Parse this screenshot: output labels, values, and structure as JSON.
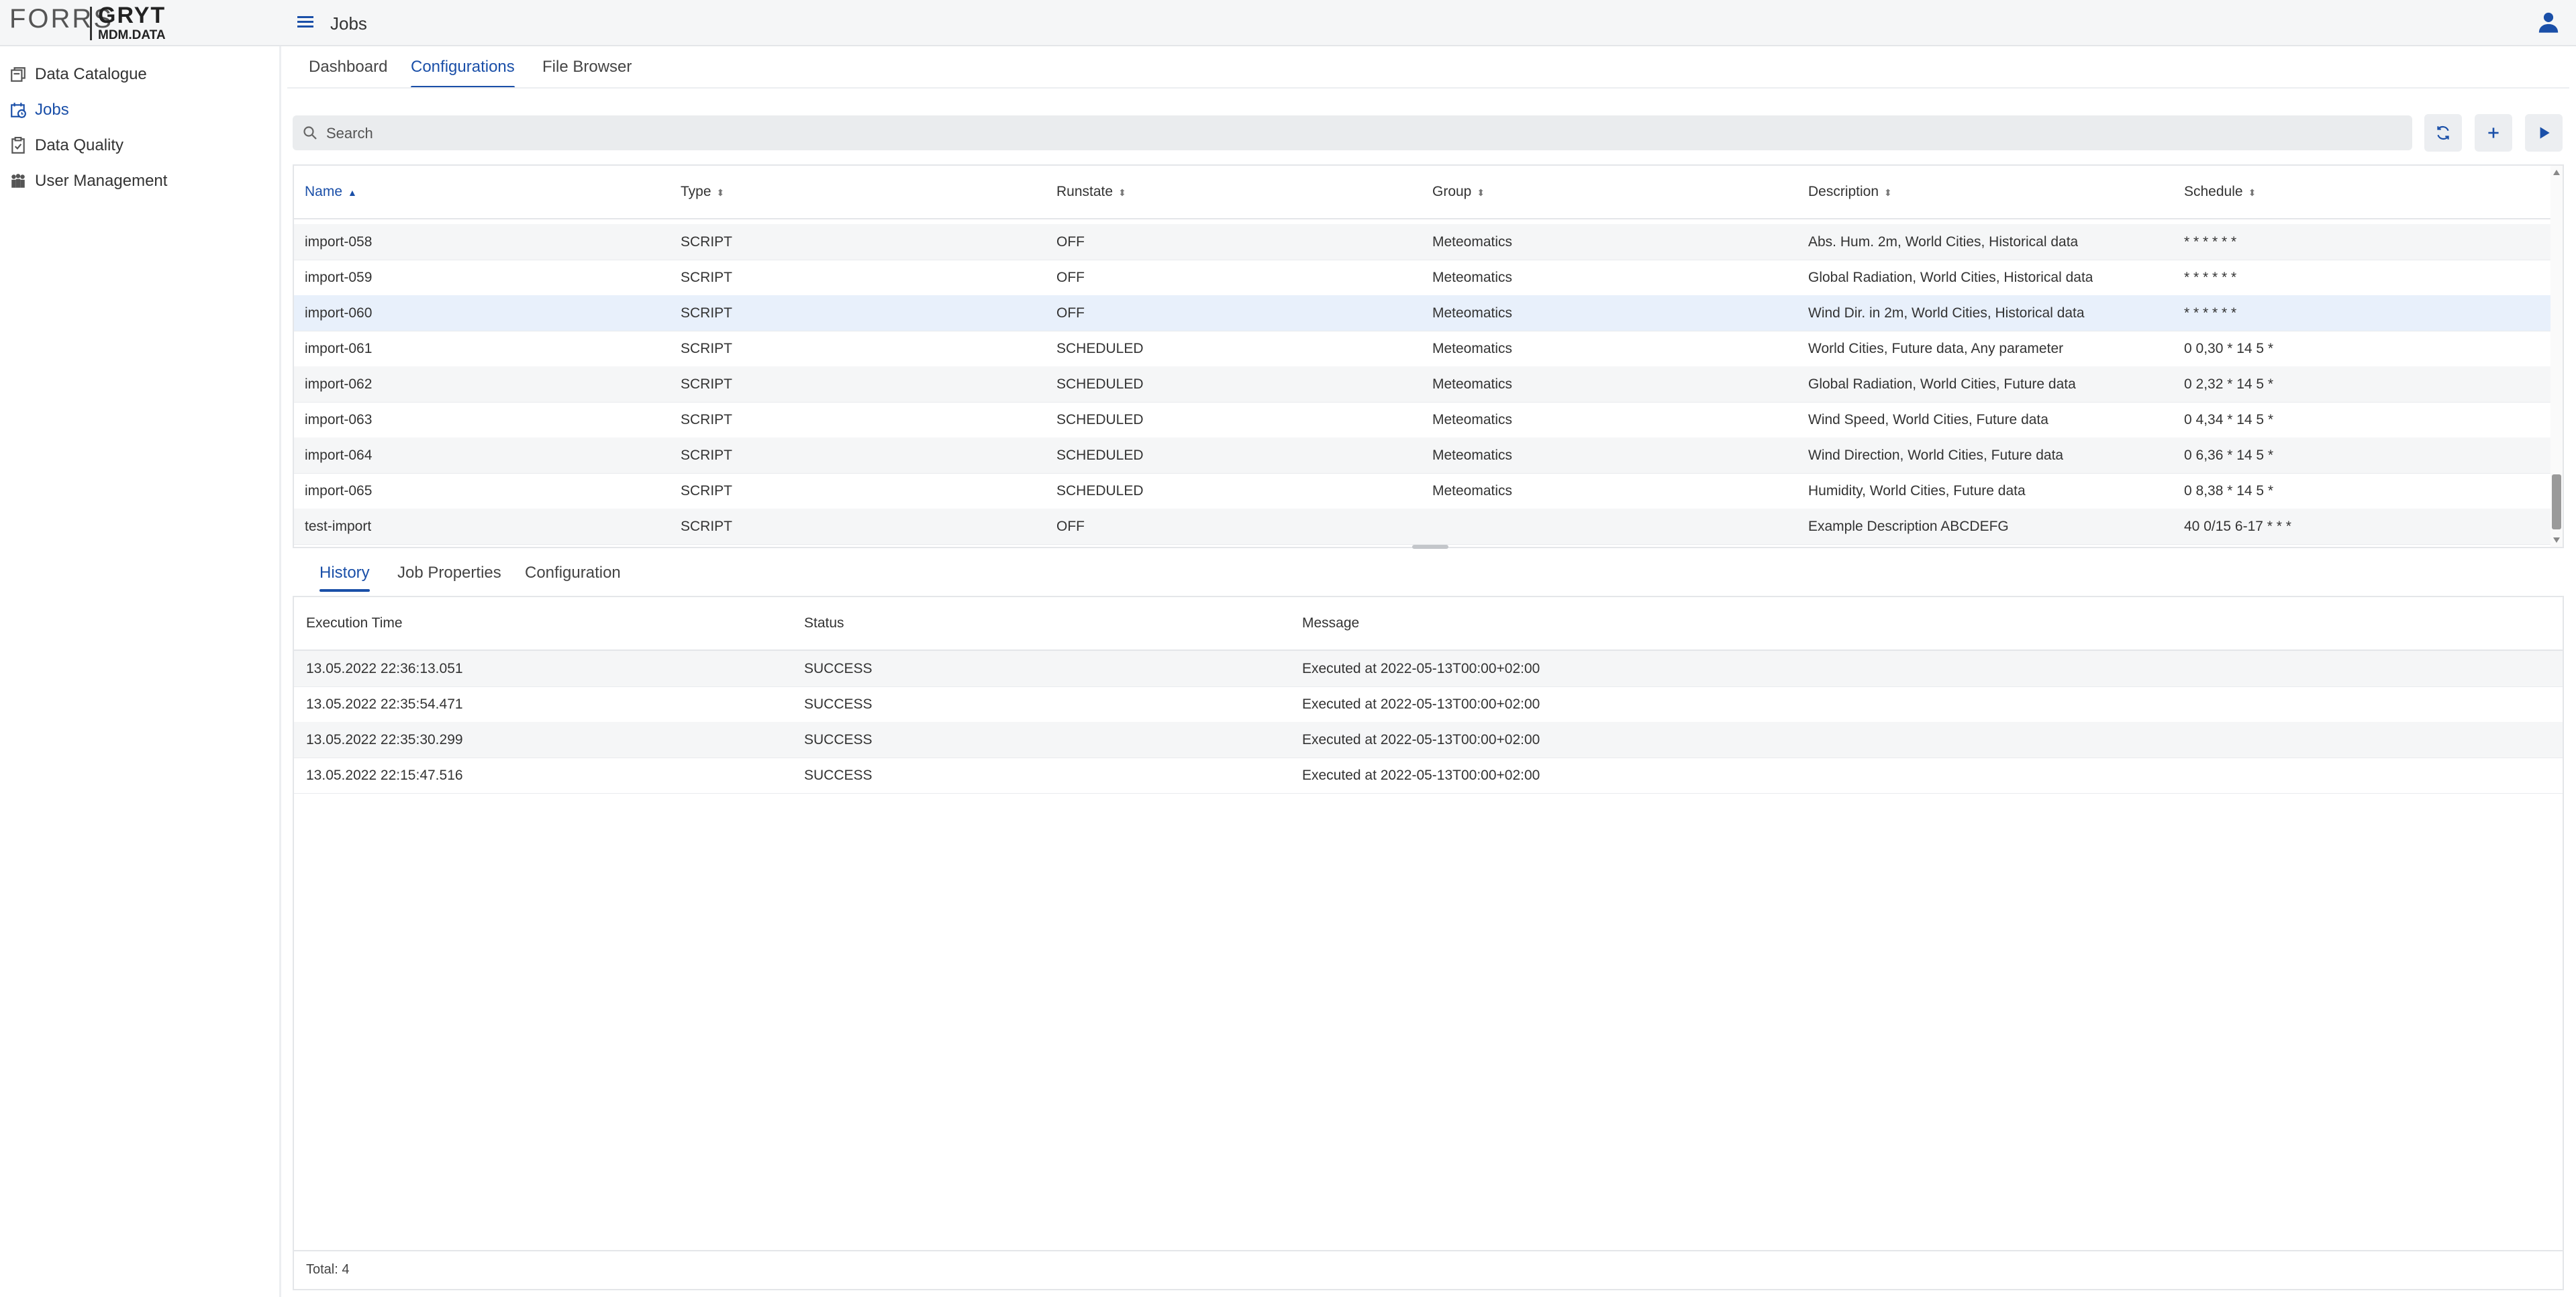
{
  "header": {
    "logo_left": "FORRS",
    "logo_right": "GRYT",
    "logo_sub": "MDM.DATA",
    "page_title": "Jobs"
  },
  "sidebar": {
    "items": [
      {
        "label": "Data Catalogue",
        "icon": "catalogue-icon"
      },
      {
        "label": "Jobs",
        "icon": "calendar-icon"
      },
      {
        "label": "Data Quality",
        "icon": "clipboard-check-icon"
      },
      {
        "label": "User Management",
        "icon": "users-icon"
      }
    ],
    "active_index": 1
  },
  "top_tabs": [
    "Dashboard",
    "Configurations",
    "File Browser"
  ],
  "active_top_tab": "Configurations",
  "search": {
    "placeholder": "Search",
    "value": ""
  },
  "toolbar": {
    "buttons": [
      "refresh-icon",
      "plus-icon",
      "play-icon"
    ]
  },
  "jobs_table": {
    "columns": [
      "Name",
      "Type",
      "Runstate",
      "Group",
      "Description",
      "Schedule"
    ],
    "sorted_column": "Name",
    "sort_direction": "ascending",
    "rows": [
      [
        "import-058",
        "SCRIPT",
        "OFF",
        "Meteomatics",
        "Abs. Hum. 2m, World Cities, Historical data",
        "* * * * * *"
      ],
      [
        "import-059",
        "SCRIPT",
        "OFF",
        "Meteomatics",
        "Global Radiation, World Cities, Historical data",
        "* * * * * *"
      ],
      [
        "import-060",
        "SCRIPT",
        "OFF",
        "Meteomatics",
        "Wind Dir. in 2m, World Cities, Historical data",
        "* * * * * *"
      ],
      [
        "import-061",
        "SCRIPT",
        "SCHEDULED",
        "Meteomatics",
        "World Cities, Future data, Any parameter",
        "0 0,30 * 14 5 *"
      ],
      [
        "import-062",
        "SCRIPT",
        "SCHEDULED",
        "Meteomatics",
        "Global Radiation, World Cities, Future data",
        "0 2,32 * 14 5 *"
      ],
      [
        "import-063",
        "SCRIPT",
        "SCHEDULED",
        "Meteomatics",
        "Wind Speed, World Cities, Future data",
        "0 4,34 * 14 5 *"
      ],
      [
        "import-064",
        "SCRIPT",
        "SCHEDULED",
        "Meteomatics",
        "Wind Direction, World Cities, Future data",
        "0 6,36 * 14 5 *"
      ],
      [
        "import-065",
        "SCRIPT",
        "SCHEDULED",
        "Meteomatics",
        "Humidity, World Cities, Future data",
        "0 8,38 * 14 5 *"
      ],
      [
        "test-import",
        "SCRIPT",
        "OFF",
        "",
        "Example Description ABCDEFG",
        "40 0/15 6-17 * * *"
      ]
    ],
    "selected_row": "import-060"
  },
  "detail_tabs": [
    "History",
    "Job Properties",
    "Configuration"
  ],
  "active_detail_tab": "History",
  "history_table": {
    "columns": [
      "Execution Time",
      "Status",
      "Message"
    ],
    "rows": [
      [
        "13.05.2022 22:36:13.051",
        "SUCCESS",
        "Executed at 2022-05-13T00:00+02:00"
      ],
      [
        "13.05.2022 22:35:54.471",
        "SUCCESS",
        "Executed at 2022-05-13T00:00+02:00"
      ],
      [
        "13.05.2022 22:35:30.299",
        "SUCCESS",
        "Executed at 2022-05-13T00:00+02:00"
      ],
      [
        "13.05.2022 22:15:47.516",
        "SUCCESS",
        "Executed at 2022-05-13T00:00+02:00"
      ]
    ],
    "footer": "Total: 4"
  },
  "colors": {
    "accent": "#1a4fa8",
    "row_alt": "#f5f6f7",
    "row_selected": "#e8f0fb"
  }
}
